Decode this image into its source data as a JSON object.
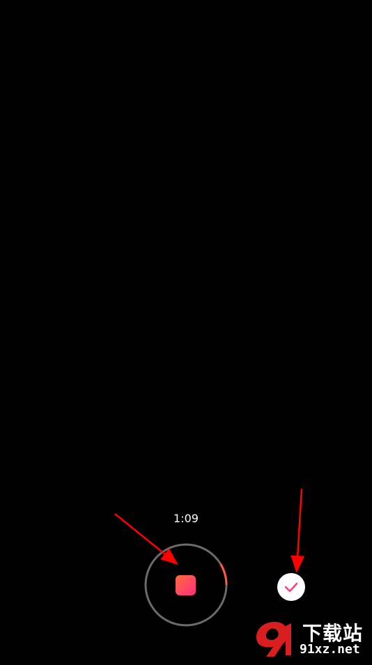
{
  "recorder": {
    "elapsed_time": "1:09",
    "progress_fraction": 0.08,
    "ring_track_color": "#6b6b6b",
    "ring_progress_color": "#ff5a3c",
    "stop_icon": "stop-square-icon",
    "confirm_icon": "checkmark-icon",
    "accent_color": "#ff3d7f"
  },
  "annotations": {
    "arrow_color": "#ff0000"
  },
  "watermark": {
    "text": "下载站",
    "url": "91xz.net",
    "logo": "91-logo-icon"
  }
}
